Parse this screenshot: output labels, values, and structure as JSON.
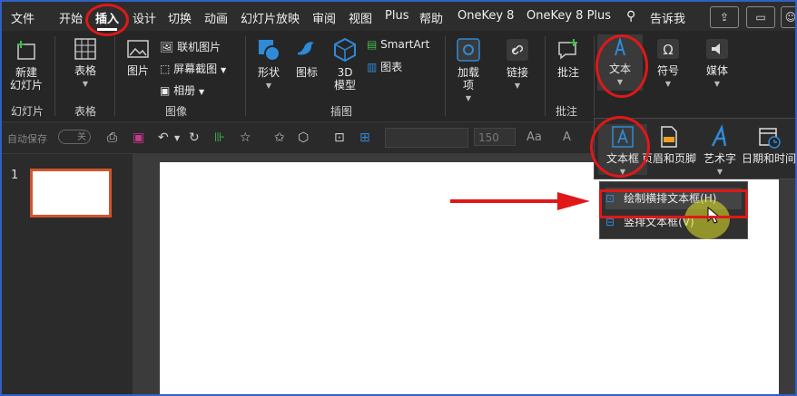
{
  "menu": {
    "items": [
      "文件",
      "开始",
      "插入",
      "设计",
      "切换",
      "动画",
      "幻灯片放映",
      "审阅",
      "视图",
      "Plus",
      "帮助",
      "OneKey 8",
      "OneKey 8 Plus"
    ],
    "active": "插入",
    "tell_me": "告诉我"
  },
  "ribbon": {
    "new_slide": "新建\n幻灯片",
    "table": "表格",
    "picture": "图片",
    "online_pictures": "联机图片",
    "screenshot": "屏幕截图",
    "album": "相册",
    "shapes": "形状",
    "icons": "图标",
    "model_3d": "3D\n模型",
    "smartart": "SmartArt",
    "chart": "图表",
    "addins": "加载\n项",
    "link": "链接",
    "comment": "批注",
    "text": "文本",
    "symbols": "符号",
    "media": "媒体",
    "groups": {
      "slides": "幻灯片",
      "tables": "表格",
      "images": "图像",
      "illustrations": "插图",
      "comments": "批注"
    }
  },
  "qat": {
    "autosave": "自动保存",
    "autosave_state": "关",
    "font_size": "150",
    "aa": "Aa",
    "grow": "A"
  },
  "slide_pane": {
    "slide_number": "1"
  },
  "text_menu": {
    "textbox": "文本框",
    "header_footer": "页眉和页脚",
    "wordart": "艺术字",
    "datetime": "日期和时间"
  },
  "textbox_menu": {
    "horizontal": "绘制横排文本框(H)",
    "vertical": "竖排文本框(V)"
  },
  "colors": {
    "accent_red": "#e01818",
    "slide_thumb_border": "#d2542c",
    "save_magenta": "#c8388c",
    "link_blue": "#2f8ad8"
  }
}
